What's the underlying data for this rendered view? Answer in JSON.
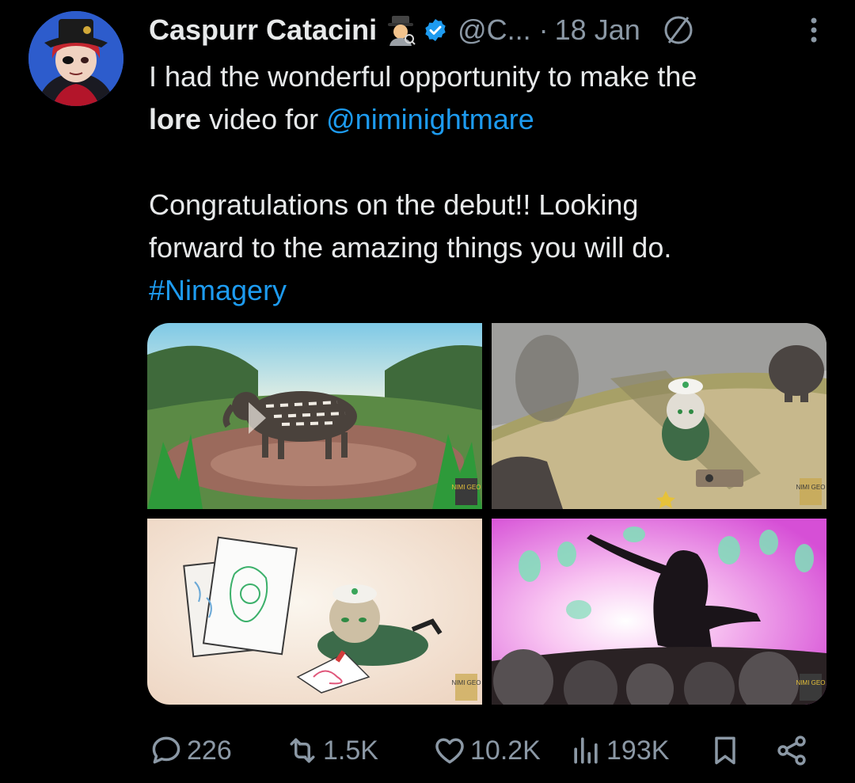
{
  "author": {
    "name": "Caspurr Catacini",
    "handle": "@C...",
    "separator": "·",
    "date": "18 Jan",
    "avatar_icon": "avatar-character-icon",
    "badge_icons": [
      "detective-emoji-icon",
      "verified-badge-icon",
      "no-entry-icon"
    ]
  },
  "post": {
    "line1": "I had the wonderful opportunity to make the",
    "bold_word": "lore",
    "line2_middle": " video for ",
    "mention": "@niminightmare",
    "line3": "Congratulations on the debut!! Looking",
    "line4": "forward to the amazing things you will do.",
    "hashtag": "#Nimagery"
  },
  "media": {
    "watermarks": [
      "NIMI GEO",
      "NIMI GEO",
      "NIMI GEO",
      "NIMI GEO"
    ]
  },
  "actions": {
    "replies": "226",
    "reposts": "1.5K",
    "likes": "10.2K",
    "views": "193K"
  },
  "colors": {
    "background": "#000000",
    "text": "#e7e9ea",
    "muted": "#8b98a5",
    "link": "#1d9bf0",
    "verified": "#1d9bf0"
  }
}
